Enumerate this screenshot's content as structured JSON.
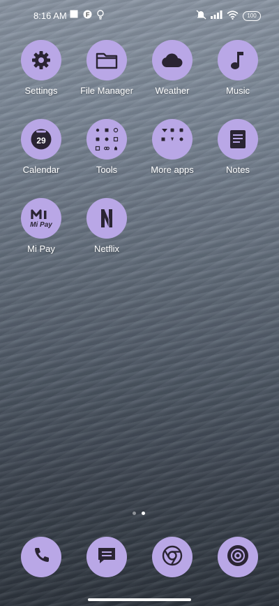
{
  "status_bar": {
    "time": "8:16 AM",
    "battery": "100"
  },
  "apps": {
    "settings": "Settings",
    "file_manager": "File Manager",
    "weather": "Weather",
    "music": "Music",
    "calendar": "Calendar",
    "calendar_day": "29",
    "tools": "Tools",
    "more_apps": "More apps",
    "notes": "Notes",
    "mi_pay": "Mi Pay",
    "mi_pay_logo_text": "Mi Pay",
    "netflix": "Netflix",
    "netflix_logo_text": "N"
  },
  "dock": [
    "phone-icon",
    "messages-icon",
    "chrome-icon",
    "camera-icon"
  ],
  "colors": {
    "icon_background": "#b9a7e6",
    "icon_glyph": "#2a2433",
    "label_text": "#ffffff"
  },
  "page_indicator": {
    "pages": 2,
    "active_page": 2
  }
}
